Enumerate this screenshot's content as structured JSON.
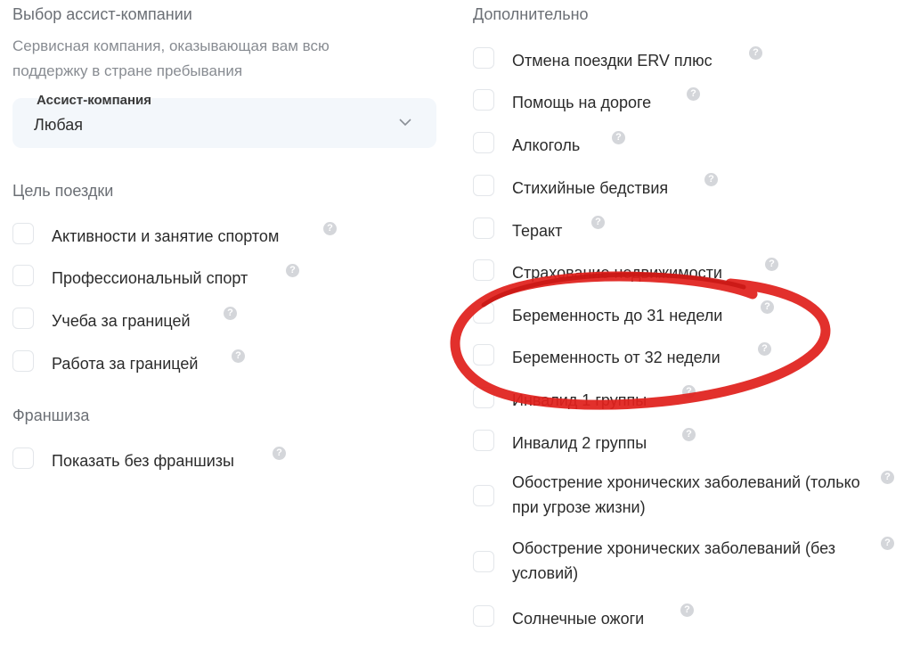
{
  "assist": {
    "title": "Выбор ассист-компании",
    "description": "Сервисная компания, оказывающая вам всю поддержку в стране пребывания",
    "select_label": "Ассист-компания",
    "select_value": "Любая"
  },
  "purpose": {
    "title": "Цель поездки",
    "items": [
      {
        "label": "Активности и занятие спортом"
      },
      {
        "label": "Профессиональный спорт"
      },
      {
        "label": "Учеба за границей"
      },
      {
        "label": "Работа за границей"
      }
    ]
  },
  "franchise": {
    "title": "Франшиза",
    "items": [
      {
        "label": "Показать без франшизы"
      }
    ]
  },
  "extra": {
    "title": "Дополнительно",
    "items": [
      {
        "label": "Отмена поездки ERV плюс"
      },
      {
        "label": "Помощь на дороге"
      },
      {
        "label": "Алкоголь"
      },
      {
        "label": "Стихийные бедствия"
      },
      {
        "label": "Теракт"
      },
      {
        "label": "Страхование недвижимости"
      },
      {
        "label": "Беременность до 31 недели"
      },
      {
        "label": "Беременность от 32 недели"
      },
      {
        "label": "Инвалид 1 группы"
      },
      {
        "label": "Инвалид 2 группы"
      },
      {
        "label": "Обострение хронических заболеваний (только при угрозе жизни)"
      },
      {
        "label": "Обострение хронических заболеваний (без условий)"
      },
      {
        "label": "Солнечные ожоги"
      }
    ]
  },
  "help_glyph": "?",
  "highlight_color": "#e0201c"
}
